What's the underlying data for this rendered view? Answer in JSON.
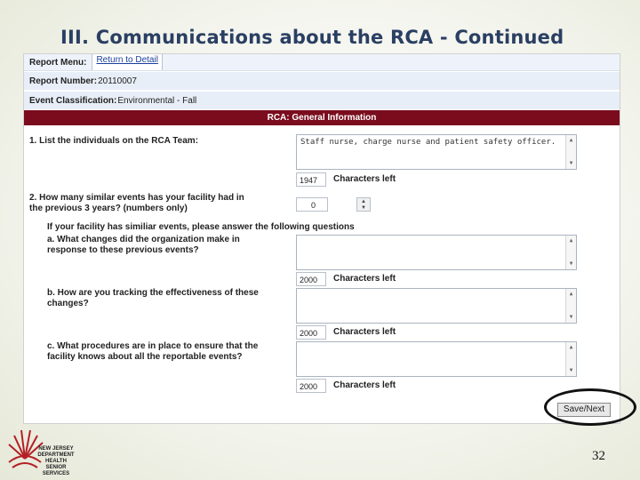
{
  "slide": {
    "title": "III. Communications about the RCA - Continued",
    "page_number": "32"
  },
  "menu": {
    "label": "Report Menu:",
    "link": "Return to Detail"
  },
  "report": {
    "number_label": "Report Number:",
    "number": "20110007",
    "classification_label": "Event Classification:",
    "classification": "Environmental - Fall"
  },
  "section": {
    "header": "RCA: General Information"
  },
  "q1": {
    "label": "1. List the individuals on the RCA Team:",
    "value": "Staff nurse, charge nurse and patient safety officer.",
    "chars": "1947",
    "chars_label": "Characters left"
  },
  "q2": {
    "label_line1": "2. How many similar events has your facility had in",
    "label_line2": "the previous 3 years? (numbers only)",
    "value": "0",
    "followup": "If your facility has similiar events, please answer the following questions"
  },
  "qa": {
    "line1": "a. What changes did the organization make in",
    "line2": "response to these previous events?",
    "chars": "2000",
    "chars_label": "Characters left"
  },
  "qb": {
    "line1": "b. How are you tracking the effectiveness of these",
    "line2": "changes?",
    "chars": "2000",
    "chars_label": "Characters left"
  },
  "qc": {
    "line1": "c. What procedures are in place to ensure that the",
    "line2": "facility knows about all the reportable events?",
    "chars": "2000",
    "chars_label": "Characters left"
  },
  "actions": {
    "save_next": "Save/Next"
  },
  "logo": {
    "line1": "NEW JERSEY",
    "line2": "DEPARTMENT",
    "line3": "HEALTH",
    "line4": "SENIOR SERVICES"
  },
  "icons": {
    "spinner": "up-down-arrow-icon",
    "scroll": "scroll-arrow-icon"
  },
  "colors": {
    "header": "#7a0c1e",
    "title": "#2a3f63",
    "link": "#1a3f9a"
  }
}
